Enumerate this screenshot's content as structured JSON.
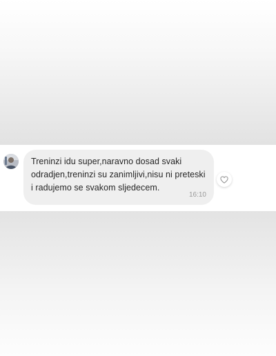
{
  "chat": {
    "message": {
      "text": "Treninzi idu super,naravno dosad svaki odradjen,treninzi su zanimljivi,nisu ni preteski i radujemo se svakom sljedecem.",
      "line1": "Treninzi idu super,naravno dosad svaki",
      "line2": "odradjen,treninzi su zanimljivi,nisu ni preteski",
      "line3": "i radujemo se svakom sljedecem.",
      "time": "16:10"
    },
    "avatar_icon": "user-avatar-photo",
    "like_icon": "heart-outline-icon",
    "colors": {
      "bubble": "#efefef",
      "text": "#262626",
      "time": "#9a9a9a"
    }
  }
}
